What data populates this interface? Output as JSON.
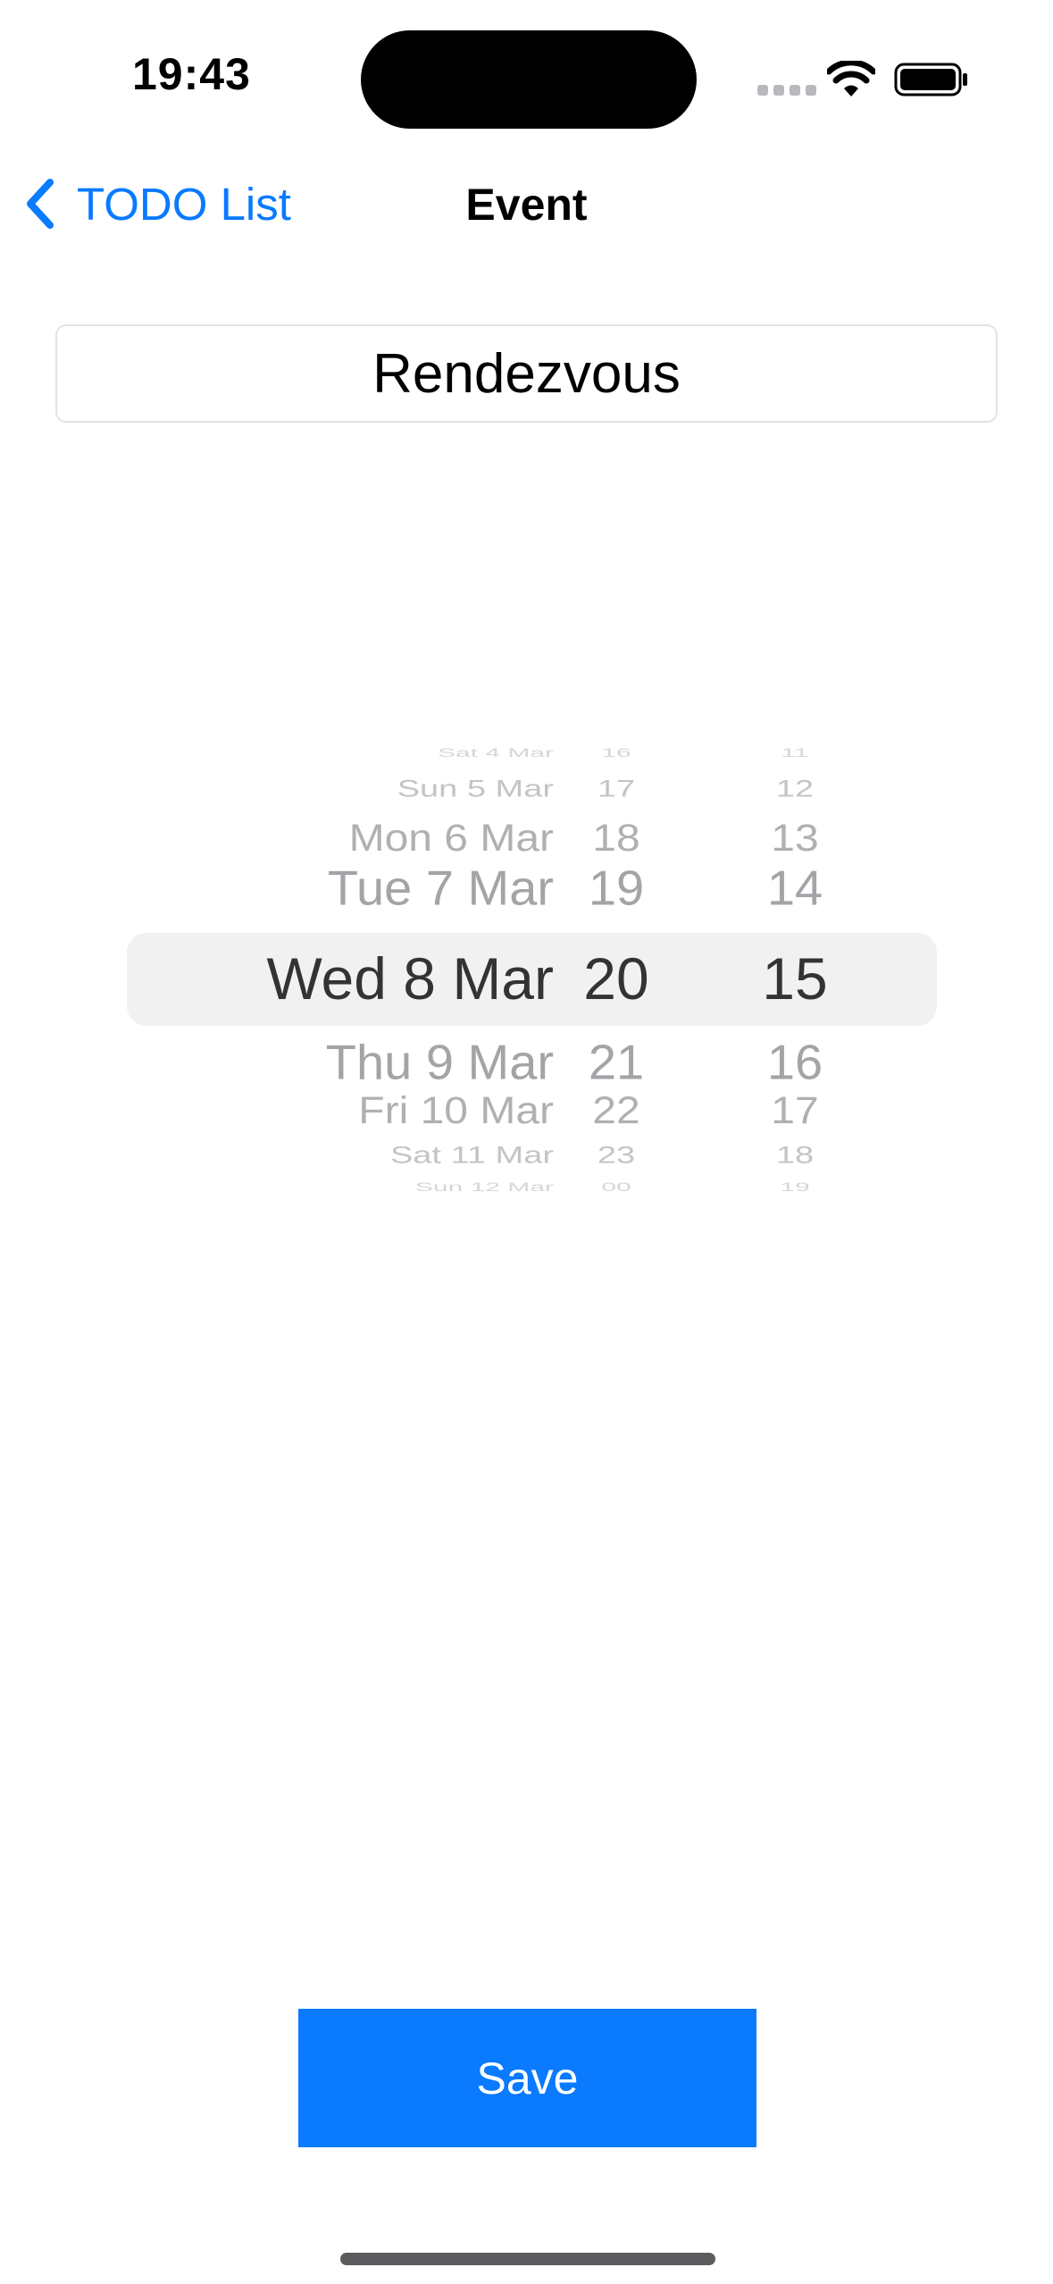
{
  "status_bar": {
    "time": "19:43"
  },
  "nav": {
    "back_label": "TODO List",
    "title": "Event"
  },
  "event_title_field": {
    "value": "Rendezvous"
  },
  "picker": {
    "selected": {
      "date": "Wed 8 Mar",
      "hour": "20",
      "minute": "15"
    },
    "dates": [
      "Sat 4 Mar",
      "Sun 5 Mar",
      "Mon 6 Mar",
      "Tue 7 Mar",
      "Wed 8 Mar",
      "Thu 9 Mar",
      "Fri 10 Mar",
      "Sat 11 Mar",
      "Sun 12 Mar"
    ],
    "hours": [
      "16",
      "17",
      "18",
      "19",
      "20",
      "21",
      "22",
      "23",
      "00"
    ],
    "minutes": [
      "11",
      "12",
      "13",
      "14",
      "15",
      "16",
      "17",
      "18",
      "19"
    ]
  },
  "save_button": {
    "label": "Save",
    "color": "#0a7aff"
  },
  "colors": {
    "accent": "#0a7aff",
    "picker_selected_text": "#333333",
    "picker_dim_text": "#a0a0a5"
  }
}
